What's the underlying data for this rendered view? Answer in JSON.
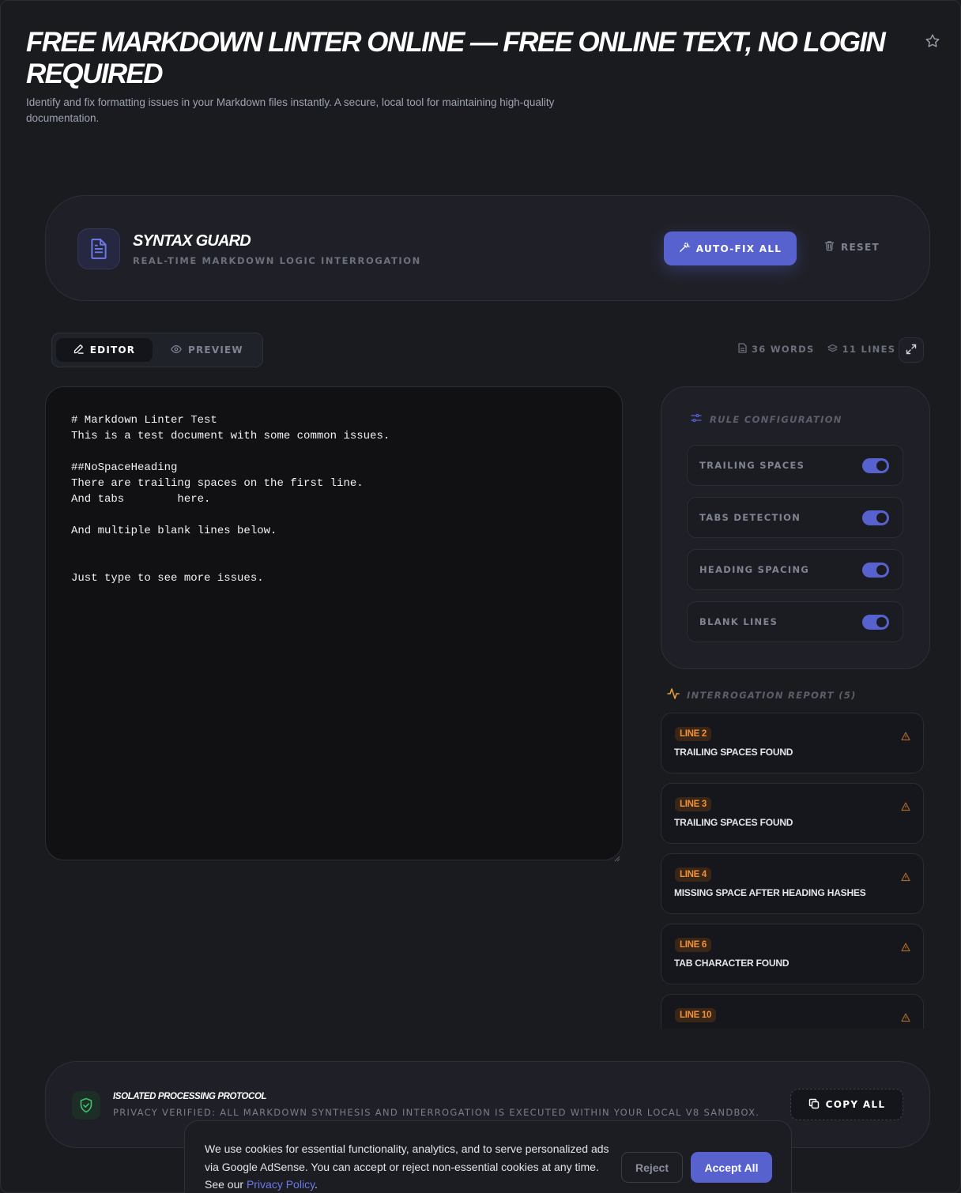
{
  "page": {
    "title": "FREE MARKDOWN LINTER ONLINE — FREE ONLINE TEXT, NO LOGIN REQUIRED",
    "subtitle": "Identify and fix formatting issues in your Markdown files instantly. A secure, local tool for maintaining high-quality documentation.",
    "favorite_icon": "star-icon"
  },
  "header": {
    "icon": "document-icon",
    "title": "SYNTAX GUARD",
    "subtitle": "REAL-TIME MARKDOWN LOGIC INTERROGATION",
    "autofix_label": "AUTO-FIX ALL",
    "autofix_icon": "magic-wand-icon",
    "reset_label": "RESET",
    "reset_icon": "trash-icon"
  },
  "tabs": {
    "editor_label": "EDITOR",
    "preview_label": "PREVIEW",
    "active": "EDITOR"
  },
  "stats": {
    "words": "36 WORDS",
    "lines": "11 LINES"
  },
  "editor": {
    "content": "# Markdown Linter Test\nThis is a test document with some common issues.\n\n##NoSpaceHeading\nThere are trailing spaces on the first line.\nAnd tabs\there.\n\nAnd multiple blank lines below.\n\n\nJust type to see more issues."
  },
  "rules": {
    "heading": "RULE CONFIGURATION",
    "items": [
      {
        "label": "TRAILING SPACES",
        "enabled": true
      },
      {
        "label": "TABS DETECTION",
        "enabled": true
      },
      {
        "label": "HEADING SPACING",
        "enabled": true
      },
      {
        "label": "BLANK LINES",
        "enabled": true
      }
    ]
  },
  "report": {
    "heading": "INTERROGATION REPORT (5)",
    "items": [
      {
        "line": "LINE 2",
        "message": "TRAILING SPACES FOUND"
      },
      {
        "line": "LINE 3",
        "message": "TRAILING SPACES FOUND"
      },
      {
        "line": "LINE 4",
        "message": "MISSING SPACE AFTER HEADING HASHES"
      },
      {
        "line": "LINE 6",
        "message": "TAB CHARACTER FOUND"
      },
      {
        "line": "LINE 10",
        "message": ""
      }
    ]
  },
  "footer": {
    "title": "ISOLATED PROCESSING PROTOCOL",
    "subtitle": "PRIVACY VERIFIED: ALL MARKDOWN SYNTHESIS AND INTERROGATION IS EXECUTED WITHIN YOUR LOCAL V8 SANDBOX.",
    "copy_label": "COPY ALL"
  },
  "cookie": {
    "text_before_link": "We use cookies for essential functionality, analytics, and to serve personalized ads via Google AdSense. You can accept or reject non-essential cookies at any time. See our ",
    "link_text": "Privacy Policy",
    "text_after_link": ".",
    "reject_label": "Reject",
    "accept_label": "Accept All"
  },
  "colors": {
    "background": "#1a1b1f",
    "accent": "#5762cf",
    "warning": "#f0923a",
    "success": "#3fbf6f"
  }
}
